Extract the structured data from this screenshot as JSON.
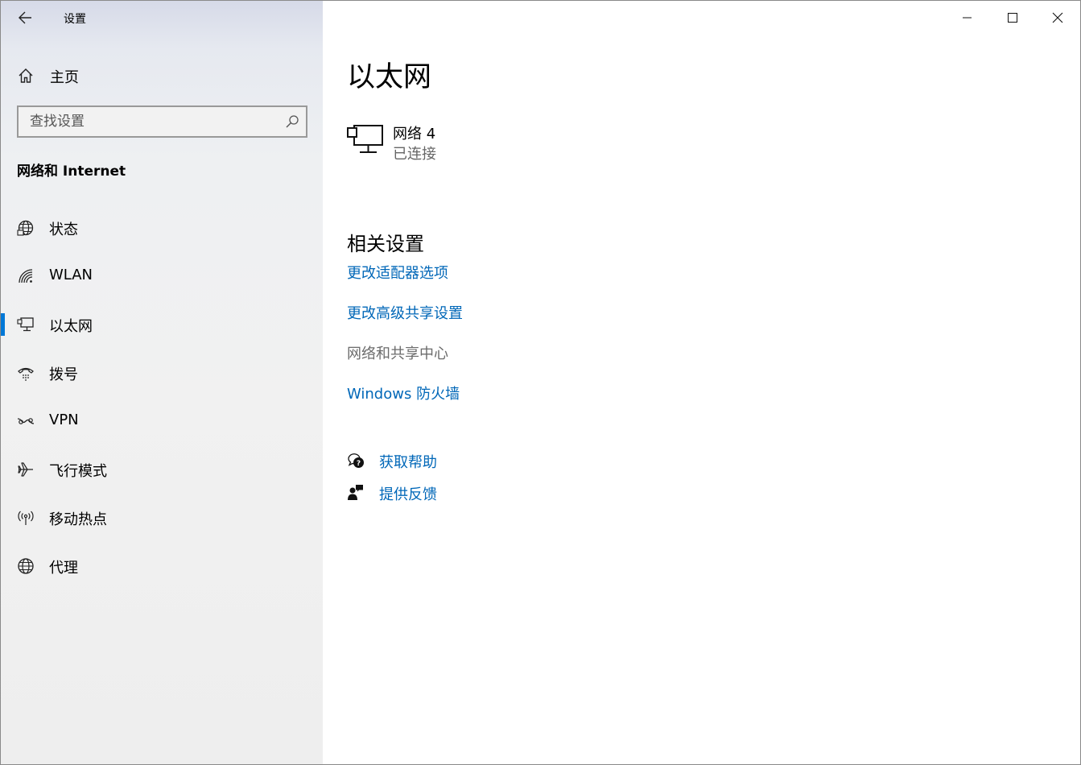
{
  "app": {
    "title": "设置"
  },
  "sidebar": {
    "home_label": "主页",
    "search_placeholder": "查找设置",
    "section_title": "网络和 Internet",
    "items": [
      {
        "label": "状态",
        "icon": "status-globe-icon"
      },
      {
        "label": "WLAN",
        "icon": "wifi-icon"
      },
      {
        "label": "以太网",
        "icon": "ethernet-icon",
        "selected": true
      },
      {
        "label": "拨号",
        "icon": "dialup-icon"
      },
      {
        "label": "VPN",
        "icon": "vpn-icon"
      },
      {
        "label": "飞行模式",
        "icon": "airplane-icon"
      },
      {
        "label": "移动热点",
        "icon": "hotspot-icon"
      },
      {
        "label": "代理",
        "icon": "globe-icon"
      }
    ],
    "accent_color": "#0078d7"
  },
  "main": {
    "title": "以太网",
    "network": {
      "name": "网络 4",
      "status": "已连接"
    },
    "related_heading": "相关设置",
    "related_links": [
      {
        "label": "更改适配器选项",
        "enabled": true
      },
      {
        "label": "更改高级共享设置",
        "enabled": true
      },
      {
        "label": "网络和共享中心",
        "enabled": false
      },
      {
        "label": "Windows 防火墙",
        "enabled": true
      }
    ],
    "help": {
      "get_help": "获取帮助",
      "feedback": "提供反馈"
    },
    "link_color": "#0067b8"
  }
}
